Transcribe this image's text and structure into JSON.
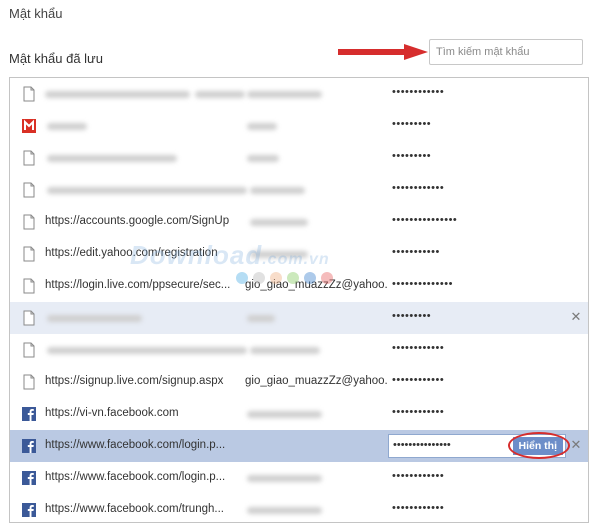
{
  "page": {
    "title": "Mật khẩu"
  },
  "saved": {
    "heading": "Mật khẩu đã lưu"
  },
  "search": {
    "placeholder": "Tìm kiếm mật khẩu",
    "value": ""
  },
  "colors": {
    "accent": "#6d8ec9",
    "selected_row": "#bac9e3",
    "hover_row": "#e7ecf5",
    "annotation": "#d62d2d"
  },
  "rows": [
    {
      "icon": "page-icon",
      "site": "",
      "user": "",
      "password": "••••••••••••"
    },
    {
      "icon": "gmail-icon",
      "site": "",
      "user": "",
      "password": "•••••••••"
    },
    {
      "icon": "page-icon",
      "site": "",
      "user": "",
      "password": "•••••••••"
    },
    {
      "icon": "page-icon",
      "site": "",
      "user": "",
      "password": "••••••••••••"
    },
    {
      "icon": "page-icon",
      "site": "https://accounts.google.com/SignUp",
      "user": "",
      "password": "•••••••••••••••"
    },
    {
      "icon": "page-icon",
      "site": "https://edit.yahoo.com/registration",
      "user": "",
      "password": "•••••••••••"
    },
    {
      "icon": "page-icon",
      "site": "https://login.live.com/ppsecure/sec...",
      "user": "gio_giao_muazzZz@yahoo...",
      "password": "••••••••••••••"
    },
    {
      "icon": "page-icon",
      "site": "",
      "user": "",
      "password": "•••••••••",
      "remove": "✕"
    },
    {
      "icon": "page-icon",
      "site": "",
      "user": "",
      "password": "••••••••••••"
    },
    {
      "icon": "page-icon",
      "site": "https://signup.live.com/signup.aspx",
      "user": "gio_giao_muazzZz@yahoo...",
      "password": "••••••••••••"
    },
    {
      "icon": "facebook-icon",
      "site": "https://vi-vn.facebook.com",
      "user": "",
      "password": "••••••••••••"
    },
    {
      "icon": "facebook-icon",
      "site": "https://www.facebook.com/login.p...",
      "user": "",
      "password": "•••••••••••••••",
      "show_label": "Hiển thị",
      "remove": "✕"
    },
    {
      "icon": "facebook-icon",
      "site": "https://www.facebook.com/login.p...",
      "user": "",
      "password": "••••••••••••"
    },
    {
      "icon": "facebook-icon",
      "site": "https://www.facebook.com/trungh...",
      "user": "",
      "password": "••••••••••••"
    }
  ],
  "watermark": {
    "brand": "Download",
    "tld": ".com.vn"
  }
}
